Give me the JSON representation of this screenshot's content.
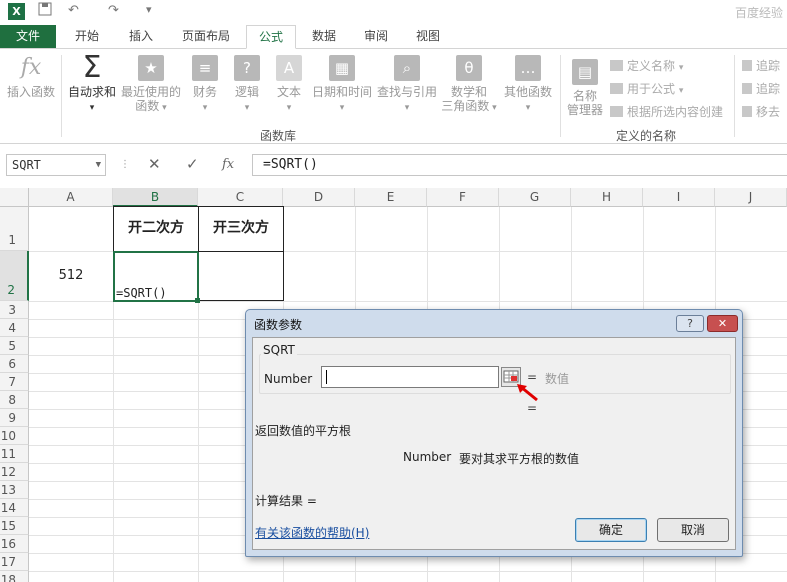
{
  "titlebar": {
    "app_icon": "X",
    "undo_glyph": "↶",
    "redo_glyph": "↷",
    "customize_glyph": "▾",
    "watermark": "百度经验"
  },
  "tabs": [
    "文件",
    "开始",
    "插入",
    "页面布局",
    "公式",
    "数据",
    "审阅",
    "视图"
  ],
  "active_tab": "公式",
  "ribbon": {
    "insert_function": "插入函数",
    "autosum": "自动求和",
    "recent_line1": "最近使用的",
    "recent_line2": "函数",
    "financial": "财务",
    "logical": "逻辑",
    "text": "文本",
    "datetime": "日期和时间",
    "lookup": "查找与引用",
    "math_line1": "数学和",
    "math_line2": "三角函数",
    "other": "其他函数",
    "name_mgr_line1": "名称",
    "name_mgr_line2": "管理器",
    "define_name": "定义名称",
    "use_in_formula": "用于公式",
    "create_from_selection": "根据所选内容创建",
    "trace_precedents": "追踪",
    "trace_dependents": "追踪",
    "remove_arrows": "移去",
    "group_library": "函数库",
    "group_names": "定义的名称"
  },
  "formula_bar": {
    "name_box": "SQRT",
    "cancel": "✕",
    "enter": "✓",
    "fx": "fx",
    "formula": "=SQRT()"
  },
  "columns": [
    "A",
    "B",
    "C",
    "D",
    "E",
    "F",
    "G",
    "H",
    "I",
    "J"
  ],
  "rows": [
    "1",
    "2",
    "3",
    "4",
    "5",
    "6",
    "7",
    "8",
    "9",
    "10",
    "11",
    "12",
    "13",
    "14",
    "15",
    "16",
    "17",
    "18"
  ],
  "cells": {
    "B1": "开二次方",
    "C1": "开三次方",
    "A2": "512",
    "B2": "=SQRT()"
  },
  "dialog": {
    "title": "函数参数",
    "help_btn": "?",
    "close_btn": "✕",
    "function_name": "SQRT",
    "arg_label": "Number",
    "arg_value": "",
    "arg_hint": "数值",
    "eq": "=",
    "description": "返回数值的平方根",
    "arg_name": "Number",
    "arg_desc": "要对其求平方根的数值",
    "result_label": "计算结果 =",
    "help_link": "有关该函数的帮助(H)",
    "ok": "确定",
    "cancel": "取消"
  },
  "colors": {
    "accent": "#217346",
    "dialog_bg": "#cfdcec",
    "arrow": "#e00000"
  }
}
